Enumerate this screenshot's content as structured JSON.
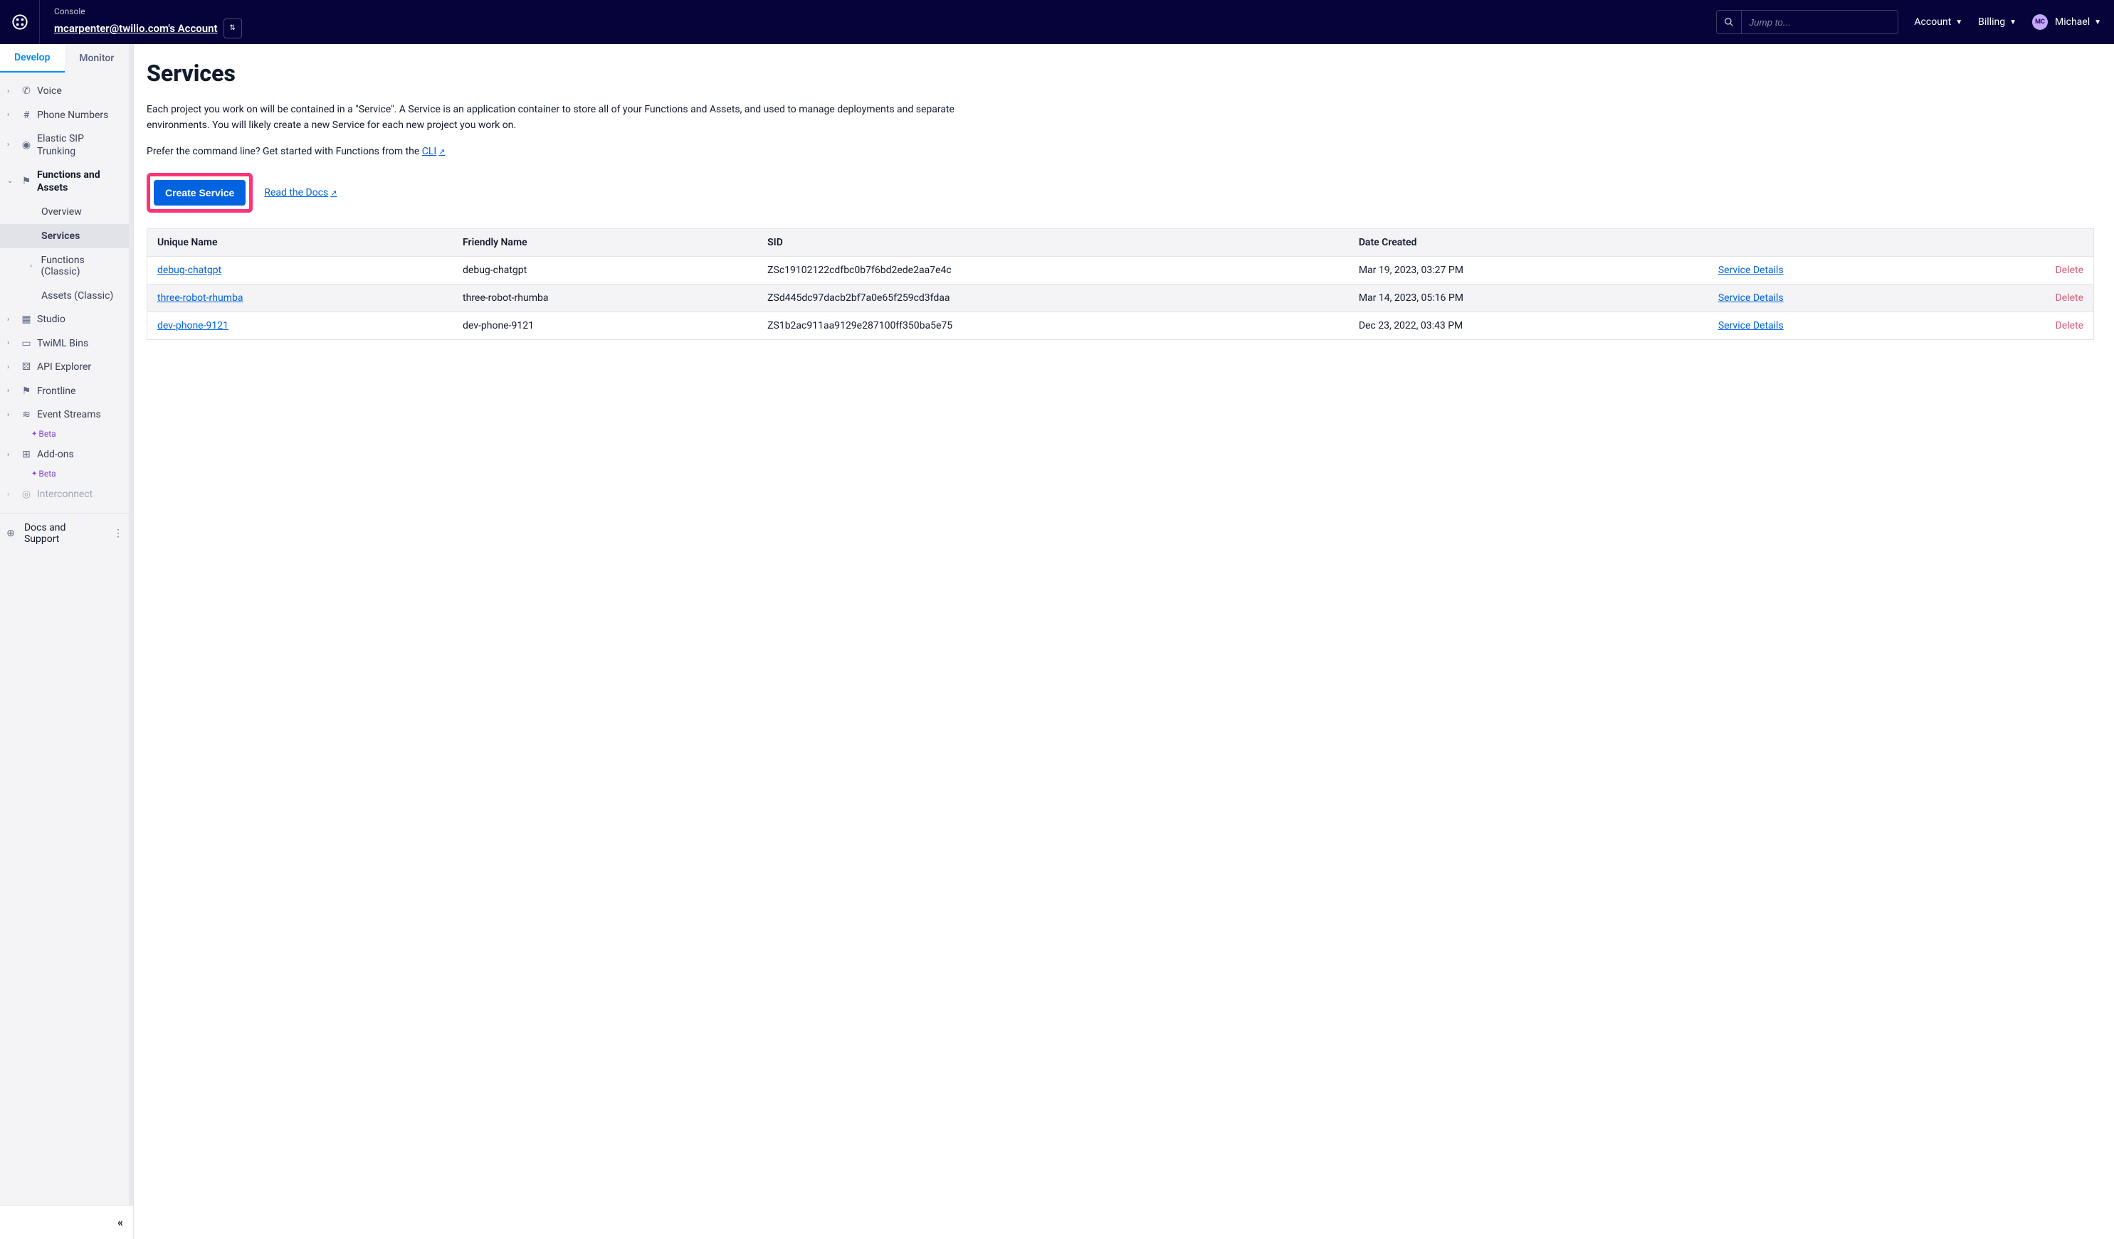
{
  "header": {
    "console_label": "Console",
    "account_name": "mcarpenter@twilio.com's Account",
    "search_placeholder": "Jump to...",
    "menu_account": "Account",
    "menu_billing": "Billing",
    "user_initials": "MC",
    "user_name": "Michael"
  },
  "sidebar": {
    "tabs": {
      "develop": "Develop",
      "monitor": "Monitor"
    },
    "items": {
      "voice": "Voice",
      "phone_numbers": "Phone Numbers",
      "elastic_sip": "Elastic SIP Trunking",
      "functions_assets": "Functions and Assets",
      "overview": "Overview",
      "services": "Services",
      "functions_classic": "Functions (Classic)",
      "assets_classic": "Assets (Classic)",
      "studio": "Studio",
      "twiml_bins": "TwiML Bins",
      "api_explorer": "API Explorer",
      "frontline": "Frontline",
      "event_streams": "Event Streams",
      "addons": "Add-ons",
      "interconnect": "Interconnect",
      "beta": "Beta",
      "docs_support": "Docs and Support"
    }
  },
  "main": {
    "title": "Services",
    "intro": "Each project you work on will be contained in a \"Service\". A Service is an application container to store all of your Functions and Assets, and used to manage deployments and separate environments. You will likely create a new Service for each new project you work on.",
    "cli_prefix": "Prefer the command line? Get started with Functions from the ",
    "cli_link": "CLI",
    "create_button": "Create Service",
    "read_docs": "Read the Docs",
    "columns": {
      "unique_name": "Unique Name",
      "friendly_name": "Friendly Name",
      "sid": "SID",
      "date_created": "Date Created"
    },
    "service_details": "Service Details",
    "delete": "Delete",
    "rows": [
      {
        "unique": "debug-chatgpt",
        "friendly": "debug-chatgpt",
        "sid": "ZSc19102122cdfbc0b7f6bd2ede2aa7e4c",
        "date": "Mar 19, 2023, 03:27 PM"
      },
      {
        "unique": "three-robot-rhumba",
        "friendly": "three-robot-rhumba",
        "sid": "ZSd445dc97dacb2bf7a0e65f259cd3fdaa",
        "date": "Mar 14, 2023, 05:16 PM"
      },
      {
        "unique": "dev-phone-9121",
        "friendly": "dev-phone-9121",
        "sid": "ZS1b2ac911aa9129e287100ff350ba5e75",
        "date": "Dec 23, 2022, 03:43 PM"
      }
    ]
  }
}
